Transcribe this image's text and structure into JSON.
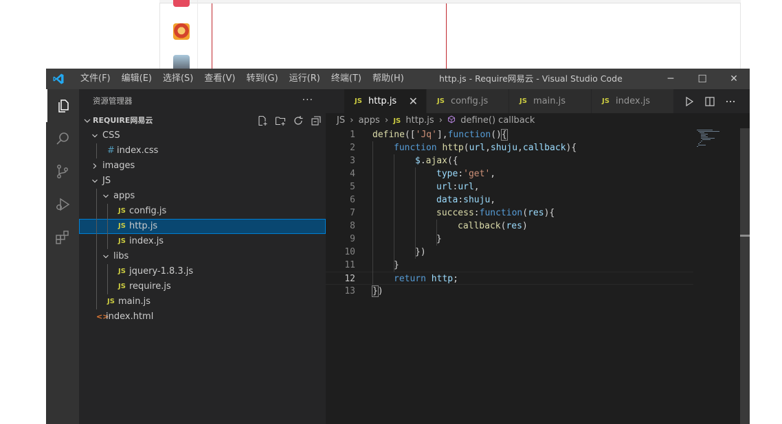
{
  "window": {
    "title": "http.js - Require网易云 - Visual Studio Code",
    "menu": [
      "文件(F)",
      "编辑(E)",
      "选择(S)",
      "查看(V)",
      "转到(G)",
      "运行(R)",
      "终端(T)",
      "帮助(H)"
    ],
    "controls": {
      "minimize": "─",
      "maximize": "☐",
      "close": "✕"
    }
  },
  "activity_bar": [
    "explorer-icon",
    "search-icon",
    "source-control-icon",
    "run-debug-icon",
    "extensions-icon"
  ],
  "sidebar": {
    "title": "资源管理器",
    "more": "···",
    "section": "REQUIRE网易云",
    "tree": [
      {
        "label": "CSS",
        "type": "folder",
        "expanded": true,
        "depth": 0
      },
      {
        "label": "index.css",
        "type": "css",
        "icon": "#",
        "depth": 1
      },
      {
        "label": "images",
        "type": "folder",
        "expanded": false,
        "depth": 0
      },
      {
        "label": "JS",
        "type": "folder",
        "expanded": true,
        "depth": 0
      },
      {
        "label": "apps",
        "type": "folder",
        "expanded": true,
        "depth": 1
      },
      {
        "label": "config.js",
        "type": "js",
        "icon": "JS",
        "depth": 2
      },
      {
        "label": "http.js",
        "type": "js",
        "icon": "JS",
        "depth": 2,
        "selected": true
      },
      {
        "label": "index.js",
        "type": "js",
        "icon": "JS",
        "depth": 2
      },
      {
        "label": "libs",
        "type": "folder",
        "expanded": true,
        "depth": 1
      },
      {
        "label": "jquery-1.8.3.js",
        "type": "js",
        "icon": "JS",
        "depth": 2
      },
      {
        "label": "require.js",
        "type": "js",
        "icon": "JS",
        "depth": 2
      },
      {
        "label": "main.js",
        "type": "js",
        "icon": "JS",
        "depth": 1
      },
      {
        "label": "index.html",
        "type": "html",
        "icon": "<>",
        "depth": 0
      }
    ]
  },
  "editor": {
    "tabs": [
      {
        "label": "http.js",
        "active": true,
        "close": "✕"
      },
      {
        "label": "config.js",
        "active": false
      },
      {
        "label": "main.js",
        "active": false
      },
      {
        "label": "index.js",
        "active": false
      }
    ],
    "breadcrumb": [
      "JS",
      "apps",
      "http.js",
      "define() callback"
    ],
    "current_line": 12,
    "lines": [
      {
        "n": "1",
        "indent": 0,
        "tokens": [
          [
            "f",
            "define"
          ],
          [
            "d",
            "(["
          ],
          [
            "s",
            "'Jq'"
          ],
          [
            "d",
            "],"
          ],
          [
            "k",
            "function"
          ],
          [
            "d",
            "()"
          ],
          [
            "d",
            "{"
          ]
        ]
      },
      {
        "n": "2",
        "indent": 1,
        "tokens": [
          [
            "k",
            "function"
          ],
          [
            "d",
            " "
          ],
          [
            "f",
            "http"
          ],
          [
            "d",
            "("
          ],
          [
            "p",
            "url"
          ],
          [
            "d",
            ","
          ],
          [
            "p",
            "shuju"
          ],
          [
            "d",
            ","
          ],
          [
            "p",
            "callback"
          ],
          [
            "d",
            "){"
          ]
        ]
      },
      {
        "n": "3",
        "indent": 2,
        "tokens": [
          [
            "p",
            "$"
          ],
          [
            "d",
            "."
          ],
          [
            "f",
            "ajax"
          ],
          [
            "d",
            "({"
          ]
        ]
      },
      {
        "n": "4",
        "indent": 3,
        "tokens": [
          [
            "p",
            "type"
          ],
          [
            "d",
            ":"
          ],
          [
            "s",
            "'get'"
          ],
          [
            "d",
            ","
          ]
        ]
      },
      {
        "n": "5",
        "indent": 3,
        "tokens": [
          [
            "p",
            "url"
          ],
          [
            "d",
            ":"
          ],
          [
            "p",
            "url"
          ],
          [
            "d",
            ","
          ]
        ]
      },
      {
        "n": "6",
        "indent": 3,
        "tokens": [
          [
            "p",
            "data"
          ],
          [
            "d",
            ":"
          ],
          [
            "p",
            "shuju"
          ],
          [
            "d",
            ","
          ]
        ]
      },
      {
        "n": "7",
        "indent": 3,
        "tokens": [
          [
            "f",
            "success"
          ],
          [
            "d",
            ":"
          ],
          [
            "k",
            "function"
          ],
          [
            "d",
            "("
          ],
          [
            "p",
            "res"
          ],
          [
            "d",
            "){"
          ]
        ]
      },
      {
        "n": "8",
        "indent": 4,
        "tokens": [
          [
            "f",
            "callback"
          ],
          [
            "d",
            "("
          ],
          [
            "p",
            "res"
          ],
          [
            "d",
            ")"
          ]
        ]
      },
      {
        "n": "9",
        "indent": 3,
        "tokens": [
          [
            "d",
            "}"
          ]
        ]
      },
      {
        "n": "10",
        "indent": 2,
        "tokens": [
          [
            "d",
            "})"
          ]
        ]
      },
      {
        "n": "11",
        "indent": 1,
        "tokens": [
          [
            "d",
            "}"
          ]
        ]
      },
      {
        "n": "12",
        "indent": 1,
        "tokens": [
          [
            "k",
            "return"
          ],
          [
            "d",
            " "
          ],
          [
            "p",
            "http"
          ],
          [
            "d",
            ";"
          ]
        ]
      },
      {
        "n": "13",
        "indent": 0,
        "tokens": [
          [
            "d",
            "}"
          ],
          [
            "d",
            ")"
          ]
        ]
      }
    ]
  }
}
